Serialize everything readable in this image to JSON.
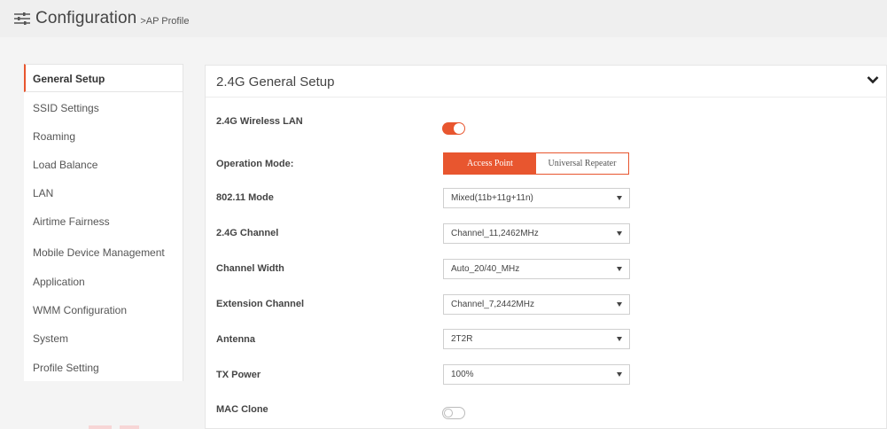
{
  "header": {
    "title": "Configuration",
    "breadcrumb": ">AP Profile",
    "icon": "sliders-icon"
  },
  "colors": {
    "accent": "#e8562f",
    "background": "#f4f4f4",
    "panel": "#ffffff"
  },
  "sidebar": {
    "items": [
      {
        "label": "General Setup",
        "active": true
      },
      {
        "label": "SSID Settings"
      },
      {
        "label": "Roaming"
      },
      {
        "label": "Load Balance"
      },
      {
        "label": "LAN"
      },
      {
        "label": "Airtime Fairness"
      },
      {
        "label": "Mobile Device Management"
      },
      {
        "label": "Application"
      },
      {
        "label": "WMM Configuration"
      },
      {
        "label": "System"
      },
      {
        "label": "Profile Setting"
      }
    ]
  },
  "panel": {
    "title": "2.4G General Setup",
    "collapse_icon": "chevron-down-icon",
    "fields": {
      "wireless_lan": {
        "label": "2.4G Wireless LAN",
        "enabled": true
      },
      "operation_mode": {
        "label": "Operation Mode:",
        "options": [
          "Access Point",
          "Universal Repeater"
        ],
        "selected": "Access Point"
      },
      "mode_80211": {
        "label": "802.11 Mode",
        "value": "Mixed(11b+11g+11n)"
      },
      "channel": {
        "label": "2.4G Channel",
        "value": "Channel_11,2462MHz"
      },
      "channel_width": {
        "label": "Channel Width",
        "value": "Auto_20/40_MHz"
      },
      "extension_channel": {
        "label": "Extension Channel",
        "value": "Channel_7,2442MHz"
      },
      "antenna": {
        "label": "Antenna",
        "value": "2T2R"
      },
      "tx_power": {
        "label": "TX Power",
        "value": "100%"
      },
      "mac_clone": {
        "label": "MAC Clone",
        "enabled": false
      }
    }
  }
}
